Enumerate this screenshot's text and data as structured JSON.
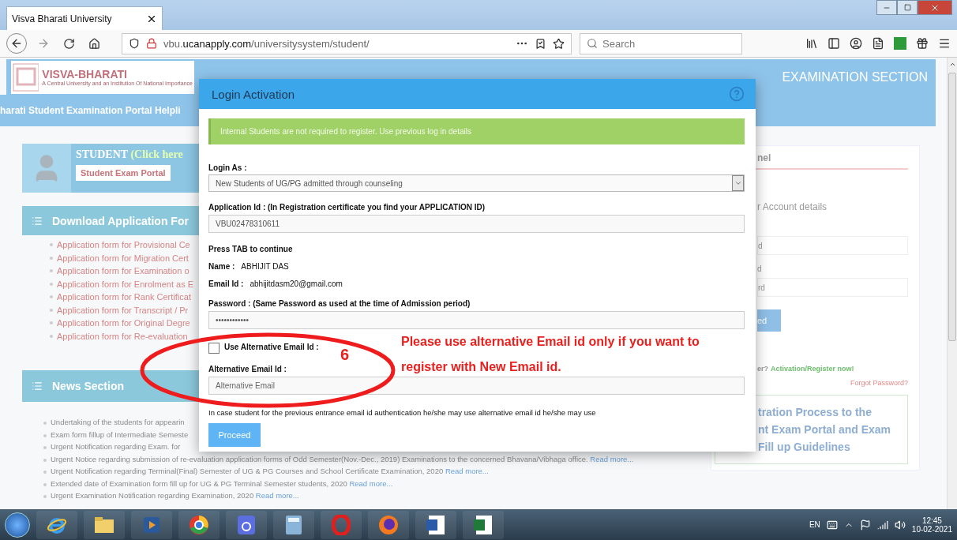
{
  "browser": {
    "tab_title": "Visva Bharati University",
    "url_host": "vbu.",
    "url_domain": "ucanapply.com",
    "url_path": "/universitysystem/student/",
    "search_placeholder": "Search"
  },
  "site": {
    "logo_title": "VISVA-BHARATI",
    "logo_subtitle": "A Central University and an Institution Of National Importance",
    "section_title": "EXAMINATION SECTION",
    "helpline": "harati Student Examination Portal Helpli",
    "student_card": {
      "title": "STUDENT",
      "hint": "(Click here",
      "button": "Student Exam Portal"
    },
    "download": {
      "title": "Download Application For",
      "items": [
        "Application form for Provisional Ce",
        "Application form for Migration Cert",
        "Application form for Examination o",
        "Application form for Enrolment as E",
        "Application form for Rank Certificat",
        "Application form for Transcript / Pr",
        "Application form for Original Degre",
        "Application form for Re-evaluation"
      ]
    },
    "news": {
      "title": "News Section",
      "items": [
        {
          "text": "Undertaking of the students for appearin"
        },
        {
          "text": "Exam form fillup of Intermediate Semeste"
        },
        {
          "text": "Urgent Notification regarding Exam. for"
        },
        {
          "text": "Urgent Notice regarding submission of re-evaluation application forms of Odd Semester(Nov.-Dec., 2019) Examinations to the concerned Bhavana/Vibhaga office.",
          "link": "Read more..."
        },
        {
          "text": "Urgent Notification regarding Terminal(Final) Semester of UG & PG Courses and School Certificate Examination, 2020",
          "link": "Read more..."
        },
        {
          "text": "Extended date of Examination form fill up for UG & PG Terminal Semester students, 2020",
          "link": "Read more..."
        },
        {
          "text": "Urgent Examination Notification regarding Examination, 2020",
          "link": "Read more..."
        }
      ]
    },
    "login_panel": {
      "title": "nel",
      "subtitle": "r Account details",
      "field_1_placeholder": "d",
      "field_2_label": "d",
      "field_2_placeholder": "rd",
      "button": "ed",
      "register_prompt": "er?",
      "register_link": "Activation/Register now!",
      "forgot_link": "Forgot Password?",
      "guide_lines": [
        "tration Process to the",
        "nt Exam Portal and Exam",
        "Fill up Guidelines"
      ]
    }
  },
  "dialog": {
    "title": "Login Activation",
    "alert": "Internal Students are not required to register. Use previous log in details",
    "fields": [
      {
        "kind": "select",
        "label": "Login As :",
        "value": "New Students of UG/PG admitted through counseling"
      },
      {
        "kind": "input",
        "label": "Application Id : (In Registration certificate you find your APPLICATION ID)",
        "value": "VBU02478310611"
      },
      {
        "kind": "hint",
        "label": "Press TAB to continue"
      },
      {
        "kind": "info",
        "label": "Name :",
        "value": "ABHIJIT DAS"
      },
      {
        "kind": "info",
        "label": "Email Id :",
        "value": "abhijitdasm20@gmail.com"
      },
      {
        "kind": "input",
        "label": "Password : (Same Password as used at the time of Admission period)",
        "value": "••••••••••••"
      },
      {
        "kind": "checkbox",
        "label": "Use Alternative Email Id :",
        "checked": false
      },
      {
        "kind": "input",
        "label": "Alternative Email Id :",
        "placeholder": "Alternative Email"
      },
      {
        "kind": "note",
        "label": "In case student for the previous entrance email id authentication he/she may use alternative email id he/she may use"
      }
    ],
    "button": "Proceed"
  },
  "annotation": {
    "number": "6",
    "note": "Please use alternative Email id only if you want to register with New Email id."
  },
  "taskbar": {
    "language": "EN",
    "time": "12:45",
    "date": "10-02-2021"
  }
}
